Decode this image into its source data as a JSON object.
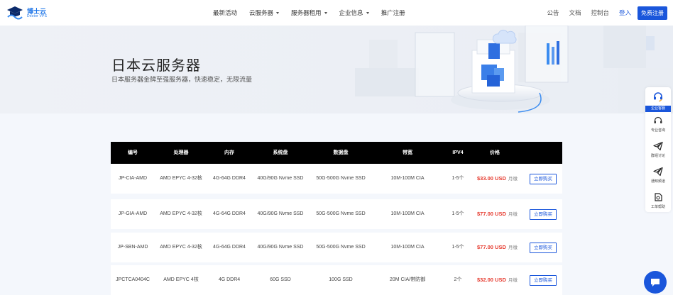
{
  "header": {
    "logo_name": "博士云",
    "logo_sub": "Doctor VPS",
    "nav": [
      {
        "label": "最新活动",
        "dropdown": false
      },
      {
        "label": "云服务器",
        "dropdown": true
      },
      {
        "label": "服务器租用",
        "dropdown": true
      },
      {
        "label": "企业信息",
        "dropdown": true
      },
      {
        "label": "推广注册",
        "dropdown": false
      }
    ],
    "links": {
      "announce": "公告",
      "docs": "文档",
      "console": "控制台",
      "login": "登入"
    },
    "register_label": "免费注册"
  },
  "banner": {
    "title": "日本云服务器",
    "subtitle": "日本服务器金牌至强服务器，快速稳定，无限流量"
  },
  "table": {
    "headers": [
      "编号",
      "处理器",
      "内存",
      "系统盘",
      "数据盘",
      "带宽",
      "IPV4",
      "价格"
    ],
    "rows": [
      {
        "id": "JP-CIA-AMD",
        "cpu": "AMD EPYC 4-32核",
        "ram": "4G-64G DDR4",
        "sys": "40G/90G Nvme SSD",
        "data": "50G-500G Nvme SSD",
        "bw": "10M-100M CIA",
        "ipv4": "1-5个",
        "price": "$33.00 USD",
        "unit": "月缴",
        "buy": "立即购买"
      },
      {
        "id": "JP-GIA-AMD",
        "cpu": "AMD EPYC 4-32核",
        "ram": "4G-64G DDR4",
        "sys": "40G/90G Nvme SSD",
        "data": "50G-500G Nvme SSD",
        "bw": "10M-100M CIA",
        "ipv4": "1-5个",
        "price": "$77.00 USD",
        "unit": "月缴",
        "buy": "立即购买"
      },
      {
        "id": "JP-SBN-AMD",
        "cpu": "AMD EPYC 4-32核",
        "ram": "4G-64G DDR4",
        "sys": "40G/90G Nvme SSD",
        "data": "50G-500G Nvme SSD",
        "bw": "10M-100M CIA",
        "ipv4": "1-5个",
        "price": "$77.00 USD",
        "unit": "月缴",
        "buy": "立即购买"
      },
      {
        "id": "JPCTCA0404C",
        "cpu": "AMD EPYC 4核",
        "ram": "4G DDR4",
        "sys": "60G SSD",
        "data": "100G SSD",
        "bw": "20M CIA/带防御",
        "ipv4": "2个",
        "price": "$32.00 USD",
        "unit": "月缴",
        "buy": "立即购买"
      }
    ]
  },
  "side": {
    "top_label": "企业客服",
    "items": [
      {
        "icon": "headset-icon",
        "label": "专业咨询"
      },
      {
        "icon": "paper-plane-icon",
        "label": "群组讨论"
      },
      {
        "icon": "paper-plane-icon",
        "label": "通知频道"
      },
      {
        "icon": "ticket-icon",
        "label": "工单帮助"
      }
    ]
  },
  "colors": {
    "brand": "#1a56db",
    "price": "#e63a2e",
    "table_head": "#000000"
  }
}
